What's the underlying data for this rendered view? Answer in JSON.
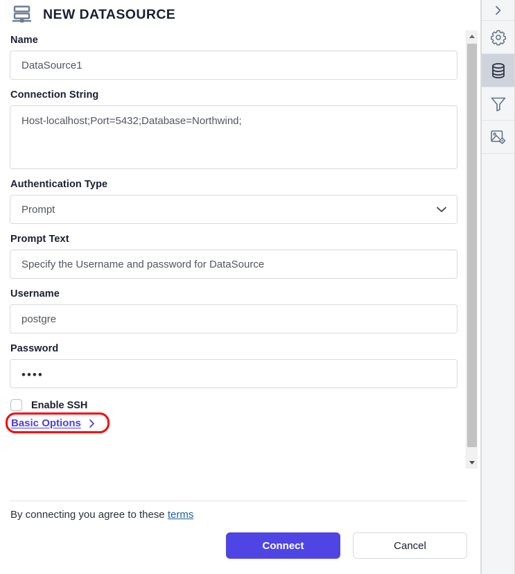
{
  "header": {
    "title": "NEW DATASOURCE",
    "icon": "datasource-icon"
  },
  "form": {
    "name": {
      "label": "Name",
      "value": "DataSource1",
      "placeholder": "Name"
    },
    "connection_string": {
      "label": "Connection String",
      "value": "Host-localhost;Port=5432;Database=Northwind;",
      "placeholder": "Connection String"
    },
    "auth_type": {
      "label": "Authentication Type",
      "value": "Prompt",
      "caret_icon": "chevron-down-icon",
      "options": [
        "Prompt"
      ]
    },
    "prompt_text": {
      "label": "Prompt Text",
      "value": "Specify the Username and password for DataSource",
      "placeholder": "Prompt Text"
    },
    "username": {
      "label": "Username",
      "value": "postgre",
      "placeholder": "Username"
    },
    "password": {
      "label": "Password",
      "value": "••••",
      "placeholder": "Password"
    },
    "enable_ssh": {
      "label": "Enable SSH",
      "checked": false
    },
    "basic_options": {
      "label": "Basic Options",
      "chevron_icon": "chevron-right-icon",
      "color": "#4a3ee8",
      "highlight_color": "#fc0007"
    }
  },
  "footer": {
    "terms_text": "By connecting you agree to these ",
    "terms_link": "terms",
    "connect_label": "Connect",
    "cancel_label": "Cancel",
    "primary_color": "#4f45e4"
  },
  "scrollbar": {
    "up_icon": "scroll-up-arrow",
    "down_icon": "scroll-down-arrow"
  },
  "rail": {
    "items": [
      {
        "name": "expand-panel",
        "icon": "chevron-right-icon",
        "active": false
      },
      {
        "name": "settings",
        "icon": "gear-icon",
        "active": false
      },
      {
        "name": "data",
        "icon": "database-icon",
        "active": true
      },
      {
        "name": "filter",
        "icon": "funnel-icon",
        "active": false
      },
      {
        "name": "image-settings",
        "icon": "image-gear-icon",
        "active": false
      }
    ]
  }
}
